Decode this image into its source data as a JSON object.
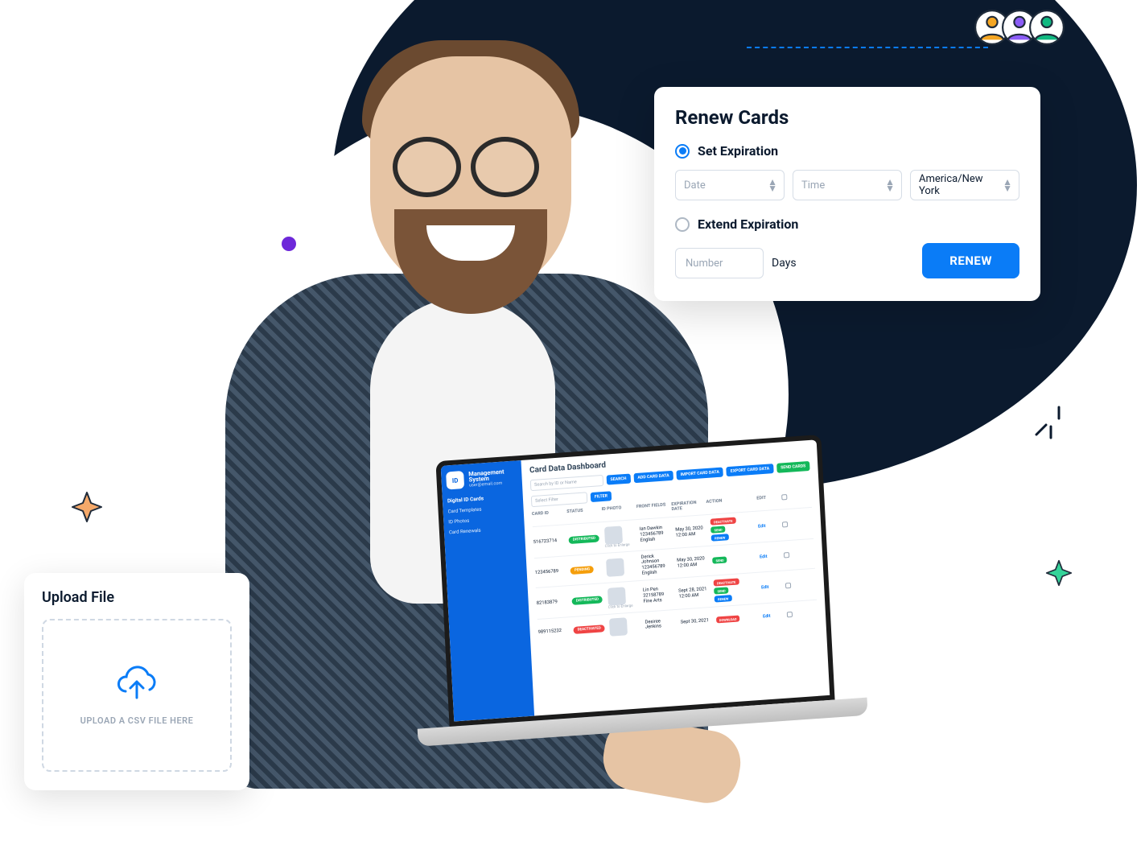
{
  "upload": {
    "title": "Upload File",
    "drop_label": "UPLOAD A CSV FILE HERE"
  },
  "renew": {
    "title": "Renew Cards",
    "set_label": "Set Expiration",
    "date_placeholder": "Date",
    "time_placeholder": "Time",
    "tz_value": "America/New York",
    "extend_label": "Extend Expiration",
    "number_placeholder": "Number",
    "days_label": "Days",
    "button": "RENEW"
  },
  "laptop": {
    "brand_badge": "ID",
    "brand_line1": "Management",
    "brand_line2": "System",
    "brand_sub": "user@email.com",
    "nav_title": "Digital ID Cards",
    "nav_items": [
      "Card Templates",
      "ID Photos",
      "Card Renewals"
    ],
    "page_title": "Card Data Dashboard",
    "search_placeholder": "Search by ID or Name",
    "btn_search": "SEARCH",
    "btn_add": "ADD CARD DATA",
    "btn_import": "IMPORT CARD DATA",
    "btn_export": "EXPORT CARD DATA",
    "btn_send": "SEND CARDS",
    "filter_placeholder": "Select Filter",
    "btn_filter": "FILTER",
    "columns": [
      "CARD ID",
      "STATUS",
      "ID PHOTO",
      "FRONT FIELDS",
      "EXPIRATION DATE",
      "ACTION",
      "EDIT",
      ""
    ],
    "rows": [
      {
        "card_id": "516723714",
        "status": {
          "label": "DISTRIBUTED",
          "color": "green"
        },
        "fields": [
          "Ian Dawkin",
          "123456789",
          "English"
        ],
        "exp": [
          "May 30, 2020",
          "12:00 AM"
        ],
        "actions": [
          [
            "DEACTIVATE",
            "red"
          ],
          [
            "SEND",
            "green"
          ],
          [
            "RENEW",
            "blue"
          ]
        ],
        "note": "Click to Enlarge"
      },
      {
        "card_id": "123456789",
        "status": {
          "label": "PENDING",
          "color": "orange"
        },
        "fields": [
          "Derick Johnson",
          "123456789",
          "English"
        ],
        "exp": [
          "May 30, 2020",
          "12:00 AM"
        ],
        "actions": [
          [
            "SEND",
            "green"
          ]
        ],
        "note": ""
      },
      {
        "card_id": "82183879",
        "status": {
          "label": "DISTRIBUTED",
          "color": "green"
        },
        "fields": [
          "Lin Pen",
          "32158789",
          "Fine Arts"
        ],
        "exp": [
          "Sept 28, 2021",
          "12:00 AM"
        ],
        "actions": [
          [
            "DEACTIVATE",
            "red"
          ],
          [
            "SEND",
            "green"
          ],
          [
            "RENEW",
            "blue"
          ]
        ],
        "note": "Click to Enlarge"
      },
      {
        "card_id": "989115232",
        "status": {
          "label": "DEACTIVATED",
          "color": "red"
        },
        "fields": [
          "Desiree Jenkins",
          "",
          ""
        ],
        "exp": [
          "Sept 30, 2021",
          ""
        ],
        "actions": [
          [
            "DOWNLOAD",
            "red"
          ]
        ],
        "note": ""
      }
    ],
    "edit_label": "Edit"
  }
}
